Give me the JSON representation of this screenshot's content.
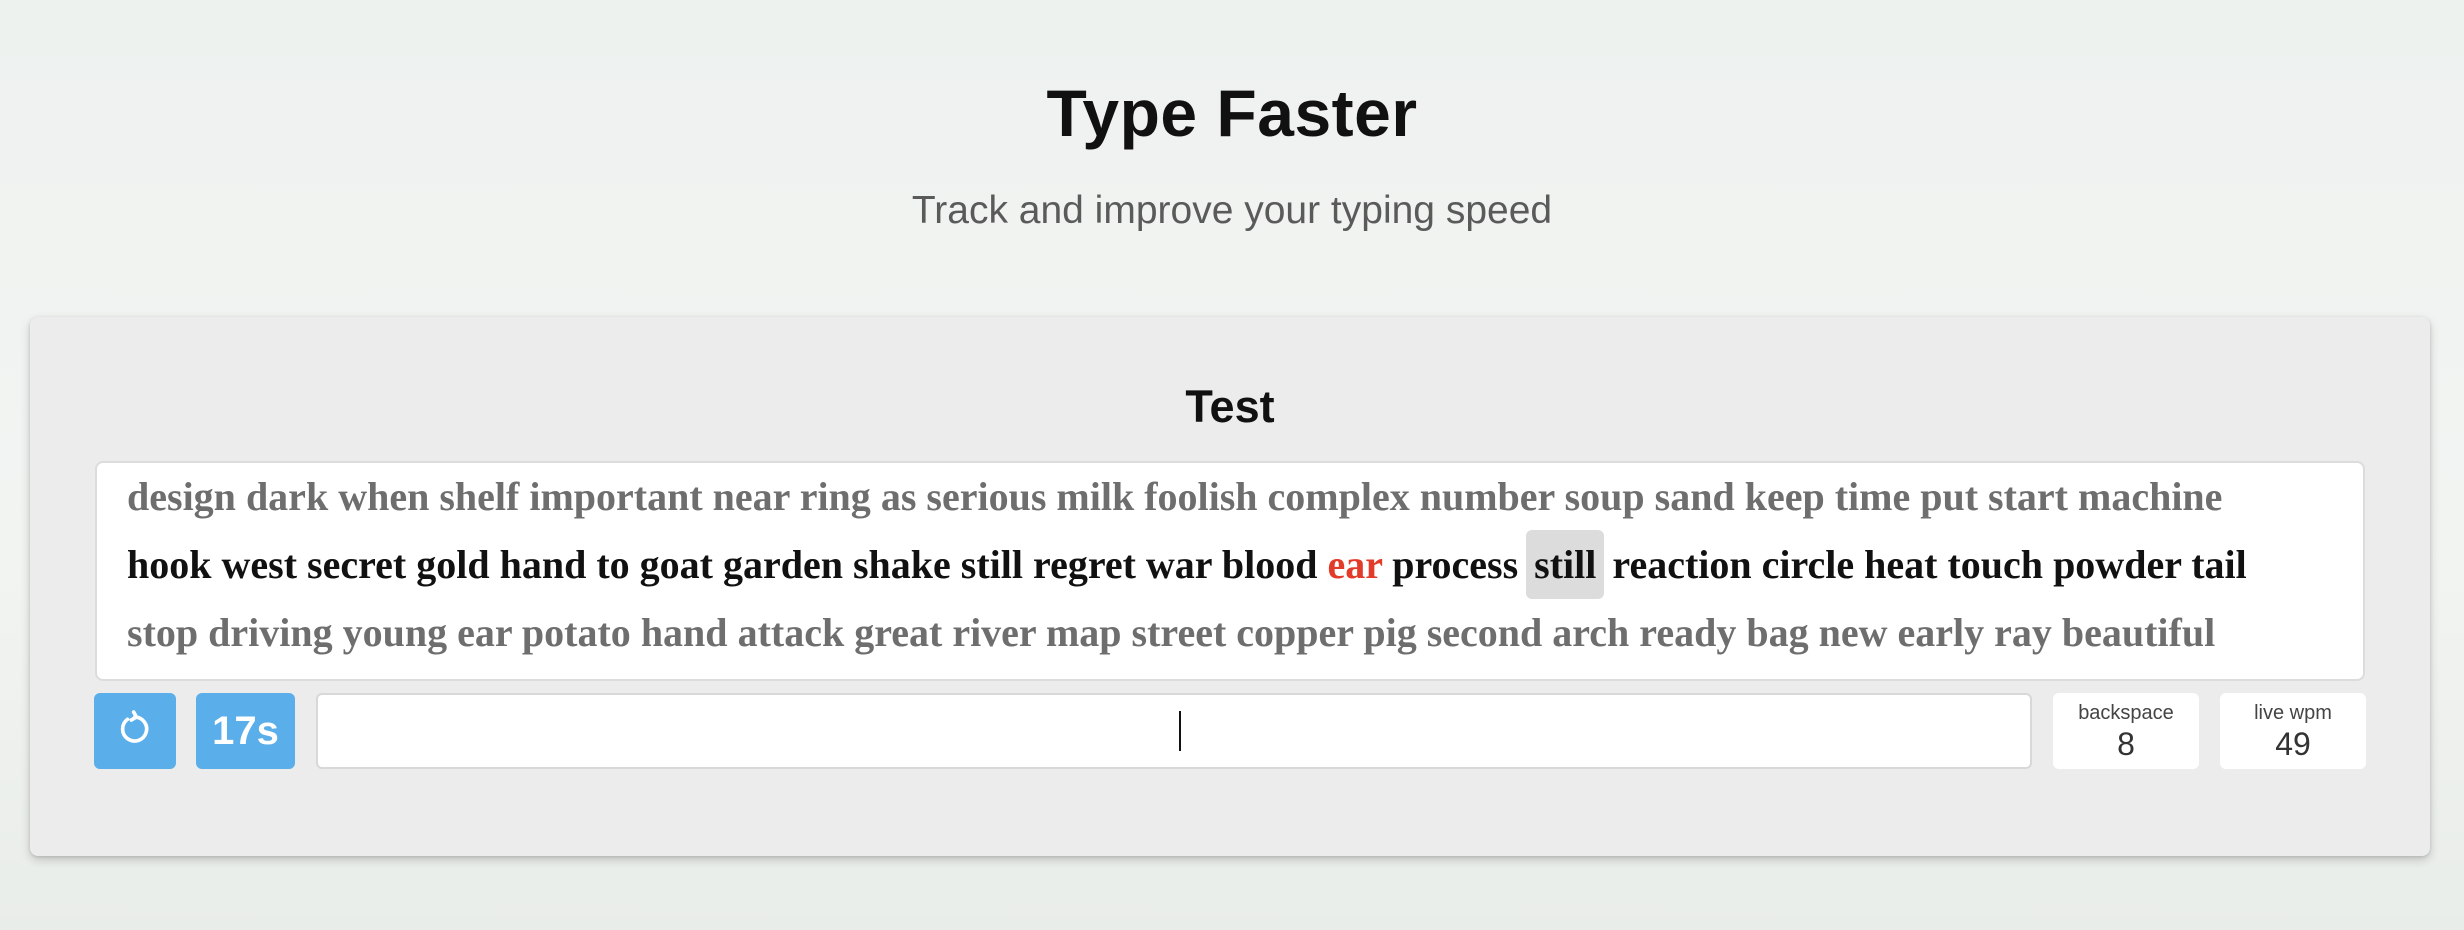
{
  "header": {
    "title": "Type Faster",
    "subtitle": "Track and improve your typing speed"
  },
  "test": {
    "title": "Test",
    "lines": [
      [
        "design",
        "dark",
        "when",
        "shelf",
        "important",
        "near",
        "ring",
        "as",
        "serious",
        "milk",
        "foolish",
        "complex",
        "number",
        "soup",
        "sand",
        "keep",
        "time",
        "put",
        "start",
        "machine"
      ],
      [
        "hook",
        "west",
        "secret",
        "gold",
        "hand",
        "to",
        "goat",
        "garden",
        "shake",
        "still",
        "regret",
        "war",
        "blood",
        "ear",
        "process",
        "still",
        "reaction",
        "circle",
        "heat",
        "touch",
        "powder",
        "tail"
      ],
      [
        "stop",
        "driving",
        "young",
        "ear",
        "potato",
        "hand",
        "attack",
        "great",
        "river",
        "map",
        "street",
        "copper",
        "pig",
        "second",
        "arch",
        "ready",
        "bag",
        "new",
        "early",
        "ray",
        "beautiful"
      ]
    ],
    "incorrect_word": {
      "line": 1,
      "index": 13
    },
    "current_word": {
      "line": 1,
      "index": 15
    }
  },
  "controls": {
    "restart_icon": "restart-icon",
    "timer_label": "17s",
    "input_value": "",
    "backspace_label": "backspace",
    "backspace_value": "8",
    "wpm_label": "live wpm",
    "wpm_value": "49"
  },
  "colors": {
    "accent": "#5aaeea",
    "error": "#e23b2a",
    "upcoming_text": "#6e6e6e",
    "active_line_text": "#111111",
    "current_word_highlight": "#dcdcdc"
  }
}
